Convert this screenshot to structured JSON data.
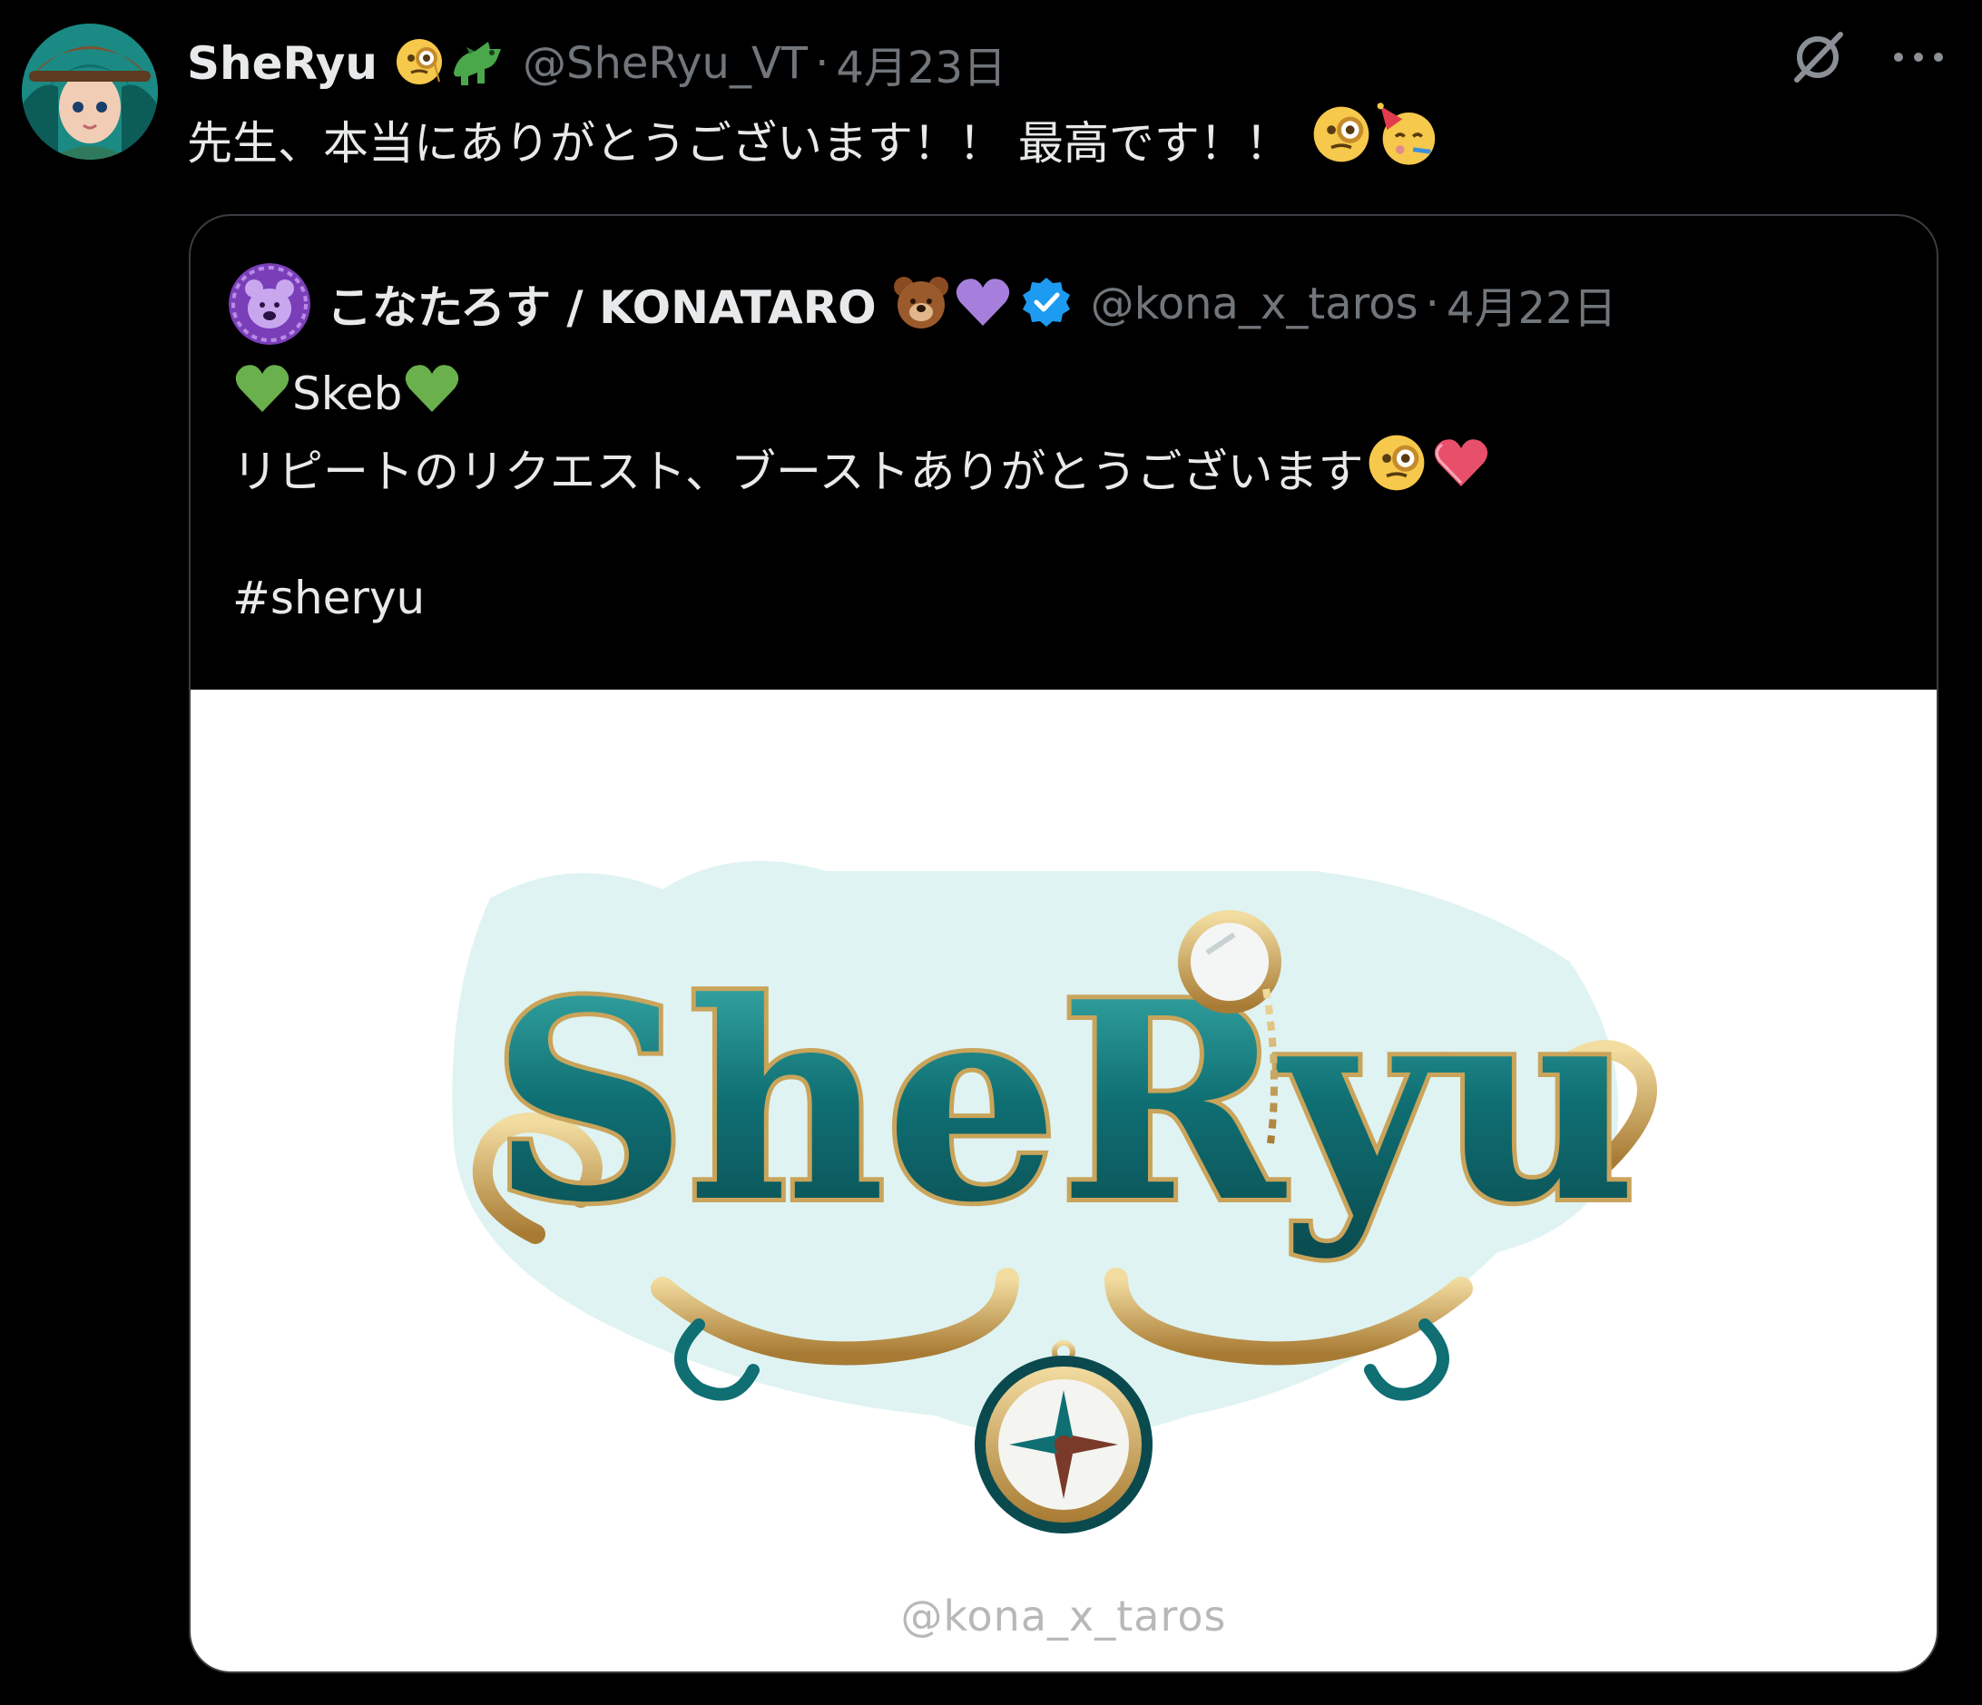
{
  "tweet": {
    "display_name": "SheRyu",
    "name_emojis": [
      "monocle-face-emoji",
      "dragon-emoji"
    ],
    "handle": "@SheRyu_VT",
    "separator": "·",
    "date": "4月23日",
    "text": "先生、本当にありがとうございます！！ 最高です！！",
    "text_emojis": [
      "monocle-face-emoji",
      "partying-face-emoji"
    ]
  },
  "actions": {
    "grok_icon": "grok-icon",
    "more_icon": "more-icon"
  },
  "quote": {
    "display_name": "こなたろす / KONATARO",
    "name_emojis": [
      "bear-emoji",
      "purple-heart-emoji"
    ],
    "verified_icon": "verified-badge-icon",
    "handle": "@kona_x_taros",
    "separator": "·",
    "date": "4月22日",
    "line1": "Skeb",
    "line1_emojis": [
      "green-heart-emoji",
      "green-heart-emoji"
    ],
    "line2": "リピートのリクエスト、ブーストありがとうございます",
    "line2_emojis": [
      "monocle-face-emoji",
      "red-heart-emoji"
    ],
    "hashtag": "#sheryu",
    "image": {
      "logo_text": "SheRyu",
      "watermark": "@kona_x_taros"
    }
  },
  "colors": {
    "background": "#000000",
    "text": "#e7e9ea",
    "muted": "#71767b",
    "verified": "#1d9bf0",
    "logo_teal": "#0f6f73",
    "logo_gold": "#c9a45a"
  }
}
